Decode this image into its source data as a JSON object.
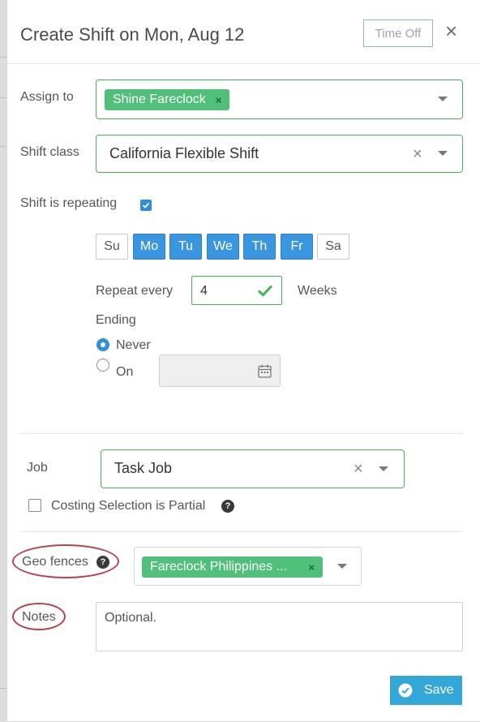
{
  "modal": {
    "title": "Create Shift on Mon, Aug 12",
    "time_off_label": "Time Off",
    "close_glyph": "×"
  },
  "assign_to": {
    "label": "Assign to",
    "chips": [
      {
        "label": "Shine Fareclock",
        "remove_glyph": "×"
      }
    ]
  },
  "shift_class": {
    "label": "Shift class",
    "value": "California Flexible Shift",
    "clear_glyph": "×"
  },
  "repeating": {
    "label": "Shift is repeating",
    "checked": true,
    "days": [
      {
        "label": "Su",
        "selected": false
      },
      {
        "label": "Mo",
        "selected": true
      },
      {
        "label": "Tu",
        "selected": true
      },
      {
        "label": "We",
        "selected": true
      },
      {
        "label": "Th",
        "selected": true
      },
      {
        "label": "Fr",
        "selected": true
      },
      {
        "label": "Sa",
        "selected": false
      }
    ],
    "repeat_every_label": "Repeat every",
    "repeat_every_value": "4",
    "repeat_unit": "Weeks",
    "ending_label": "Ending",
    "ending_options": [
      {
        "label": "Never",
        "selected": true
      },
      {
        "label": "On",
        "selected": false
      }
    ],
    "end_date_value": ""
  },
  "job": {
    "label": "Job",
    "value": "Task Job",
    "clear_glyph": "×",
    "costing_partial_label": "Costing Selection is Partial",
    "costing_partial_checked": false,
    "help_glyph": "?"
  },
  "geo_fences": {
    "label": "Geo fences",
    "help_glyph": "?",
    "chips": [
      {
        "label": "Fareclock Philippines ...",
        "remove_glyph": "×"
      }
    ]
  },
  "notes": {
    "label": "Notes",
    "placeholder": "Optional."
  },
  "footer": {
    "save_label": "Save"
  },
  "icons": {
    "caret": "chevron-down-icon",
    "calendar": "calendar-icon",
    "check": "checkmark-icon",
    "save": "check-circle-icon"
  },
  "colors": {
    "accent_blue": "#3b96e0",
    "success_green": "#45b552",
    "chip_green": "#4fbf7a",
    "save_button": "#33a7d8",
    "annotation_red": "#b8414f"
  }
}
